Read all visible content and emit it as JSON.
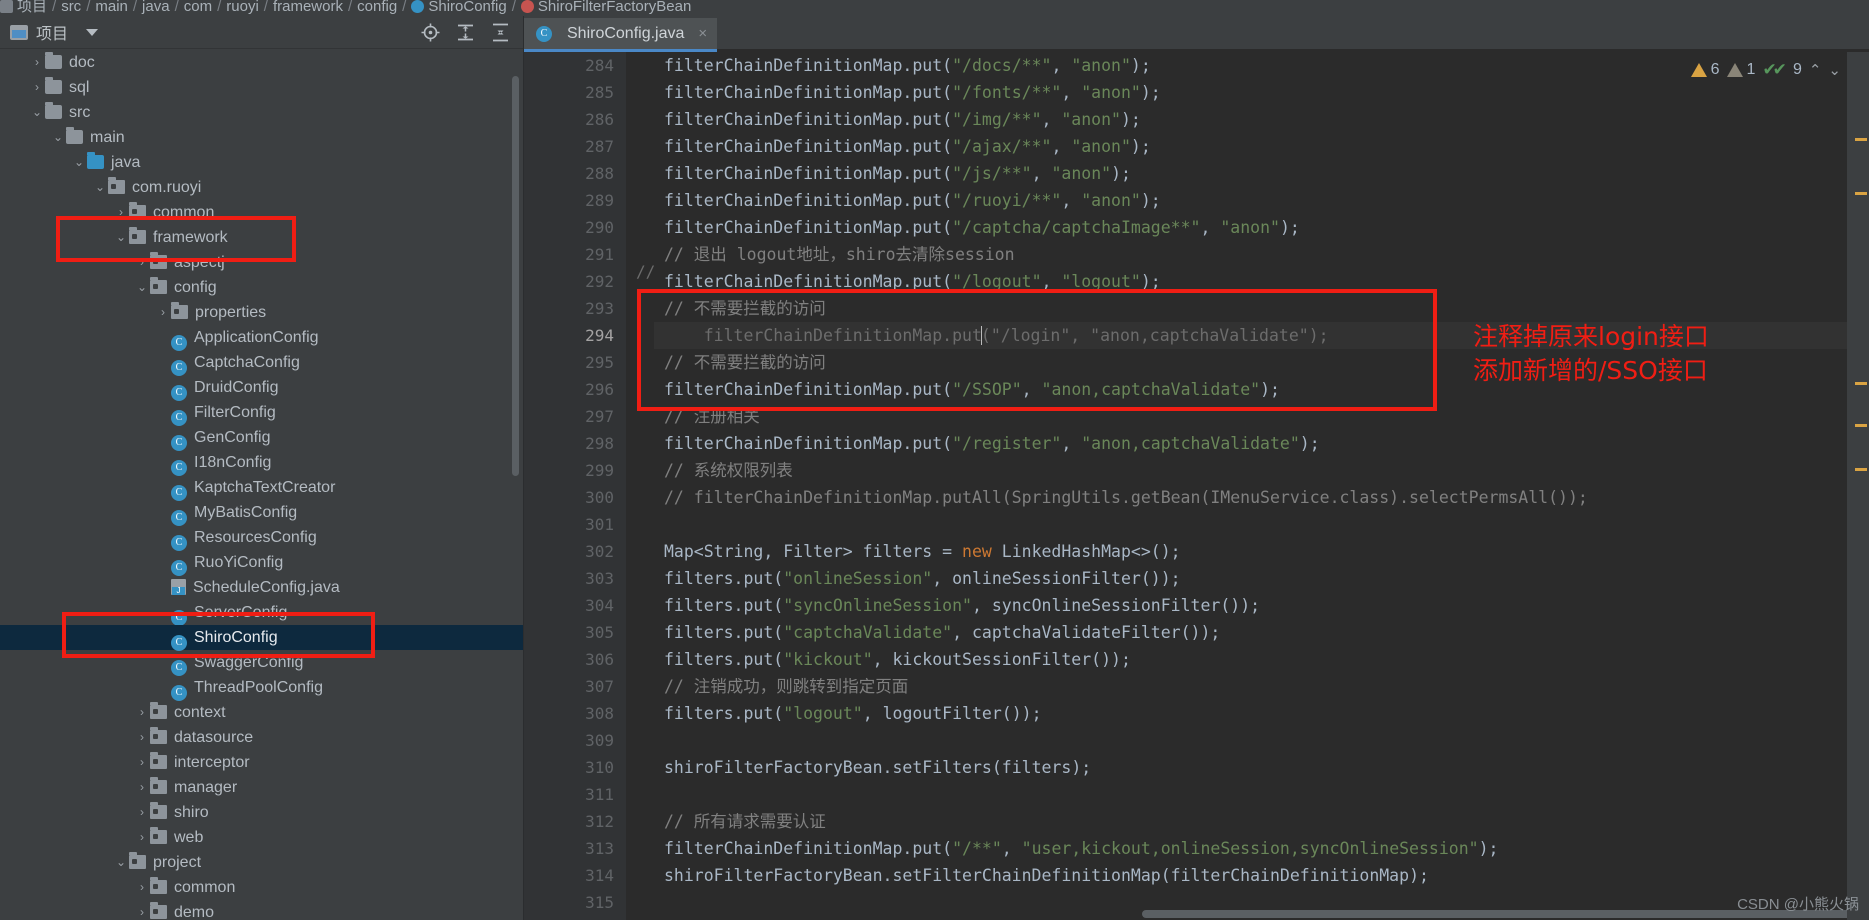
{
  "breadcrumb": {
    "items": [
      "项目",
      "src",
      "main",
      "java",
      "com",
      "ruoyi",
      "framework",
      "config",
      "ShiroConfig",
      "ShiroFilterFactoryBean"
    ],
    "separator": "/"
  },
  "project_panel": {
    "title": "项目",
    "caret": "chevron-down-icon",
    "toolbar_buttons": [
      "locate-icon",
      "expand-all-icon",
      "collapse-all-icon"
    ],
    "tree": [
      {
        "label": "doc",
        "indent": 1,
        "arrow": "collapsed",
        "icon": "folder"
      },
      {
        "label": "sql",
        "indent": 1,
        "arrow": "collapsed",
        "icon": "folder"
      },
      {
        "label": "src",
        "indent": 1,
        "arrow": "expanded",
        "icon": "folder"
      },
      {
        "label": "main",
        "indent": 2,
        "arrow": "expanded",
        "icon": "folder"
      },
      {
        "label": "java",
        "indent": 3,
        "arrow": "expanded",
        "icon": "folder-blue"
      },
      {
        "label": "com.ruoyi",
        "indent": 4,
        "arrow": "expanded",
        "icon": "package"
      },
      {
        "label": "common",
        "indent": 5,
        "arrow": "collapsed",
        "icon": "package"
      },
      {
        "label": "framework",
        "indent": 5,
        "arrow": "expanded",
        "icon": "package"
      },
      {
        "label": "aspectj",
        "indent": 6,
        "arrow": "collapsed",
        "icon": "package"
      },
      {
        "label": "config",
        "indent": 6,
        "arrow": "expanded",
        "icon": "package"
      },
      {
        "label": "properties",
        "indent": 7,
        "arrow": "collapsed",
        "icon": "package"
      },
      {
        "label": "ApplicationConfig",
        "indent": 7,
        "arrow": "none",
        "icon": "class"
      },
      {
        "label": "CaptchaConfig",
        "indent": 7,
        "arrow": "none",
        "icon": "class"
      },
      {
        "label": "DruidConfig",
        "indent": 7,
        "arrow": "none",
        "icon": "class"
      },
      {
        "label": "FilterConfig",
        "indent": 7,
        "arrow": "none",
        "icon": "class"
      },
      {
        "label": "GenConfig",
        "indent": 7,
        "arrow": "none",
        "icon": "class"
      },
      {
        "label": "I18nConfig",
        "indent": 7,
        "arrow": "none",
        "icon": "class"
      },
      {
        "label": "KaptchaTextCreator",
        "indent": 7,
        "arrow": "none",
        "icon": "class"
      },
      {
        "label": "MyBatisConfig",
        "indent": 7,
        "arrow": "none",
        "icon": "class"
      },
      {
        "label": "ResourcesConfig",
        "indent": 7,
        "arrow": "none",
        "icon": "class"
      },
      {
        "label": "RuoYiConfig",
        "indent": 7,
        "arrow": "none",
        "icon": "class"
      },
      {
        "label": "ScheduleConfig.java",
        "indent": 7,
        "arrow": "none",
        "icon": "java-file"
      },
      {
        "label": "ServerConfig",
        "indent": 7,
        "arrow": "none",
        "icon": "class"
      },
      {
        "label": "ShiroConfig",
        "indent": 7,
        "arrow": "none",
        "icon": "class",
        "selected": true
      },
      {
        "label": "SwaggerConfig",
        "indent": 7,
        "arrow": "none",
        "icon": "class"
      },
      {
        "label": "ThreadPoolConfig",
        "indent": 7,
        "arrow": "none",
        "icon": "class"
      },
      {
        "label": "context",
        "indent": 6,
        "arrow": "collapsed",
        "icon": "package"
      },
      {
        "label": "datasource",
        "indent": 6,
        "arrow": "collapsed",
        "icon": "package"
      },
      {
        "label": "interceptor",
        "indent": 6,
        "arrow": "collapsed",
        "icon": "package"
      },
      {
        "label": "manager",
        "indent": 6,
        "arrow": "collapsed",
        "icon": "package"
      },
      {
        "label": "shiro",
        "indent": 6,
        "arrow": "collapsed",
        "icon": "package"
      },
      {
        "label": "web",
        "indent": 6,
        "arrow": "collapsed",
        "icon": "package"
      },
      {
        "label": "project",
        "indent": 5,
        "arrow": "expanded",
        "icon": "package"
      },
      {
        "label": "common",
        "indent": 6,
        "arrow": "collapsed",
        "icon": "package"
      },
      {
        "label": "demo",
        "indent": 6,
        "arrow": "collapsed",
        "icon": "package"
      }
    ]
  },
  "editor": {
    "tab": {
      "label": "ShiroConfig.java",
      "icon": "class-icon",
      "close": "×"
    },
    "toolbar_buttons": [
      "settings-gear-icon",
      "minimize-icon"
    ],
    "first_line_number": 284,
    "current_line": 294,
    "lines": [
      {
        "n": 284,
        "fold": "",
        "text": "filterChainDefinitionMap.put(\"/docs/**\", \"anon\");"
      },
      {
        "n": 285,
        "fold": "",
        "text": "filterChainDefinitionMap.put(\"/fonts/**\", \"anon\");"
      },
      {
        "n": 286,
        "fold": "",
        "text": "filterChainDefinitionMap.put(\"/img/**\", \"anon\");"
      },
      {
        "n": 287,
        "fold": "",
        "text": "filterChainDefinitionMap.put(\"/ajax/**\", \"anon\");"
      },
      {
        "n": 288,
        "fold": "",
        "text": "filterChainDefinitionMap.put(\"/js/**\", \"anon\");"
      },
      {
        "n": 289,
        "fold": "",
        "text": "filterChainDefinitionMap.put(\"/ruoyi/**\", \"anon\");"
      },
      {
        "n": 290,
        "fold": "",
        "text": "filterChainDefinitionMap.put(\"/captcha/captchaImage**\", \"anon\");"
      },
      {
        "n": 291,
        "fold": "",
        "text": "// 退出 logout地址，shiro去清除session"
      },
      {
        "n": 292,
        "fold": "",
        "text": "filterChainDefinitionMap.put(\"/logout\", \"logout\");"
      },
      {
        "n": 293,
        "fold": "open",
        "text": "// 不需要拦截的访问"
      },
      {
        "n": 294,
        "fold": "",
        "text": "    filterChainDefinitionMap.put(\"/login\", \"anon,captchaValidate\");",
        "commented": true,
        "marker": "//"
      },
      {
        "n": 295,
        "fold": "close",
        "text": "// 不需要拦截的访问"
      },
      {
        "n": 296,
        "fold": "",
        "text": "filterChainDefinitionMap.put(\"/SSOP\", \"anon,captchaValidate\");"
      },
      {
        "n": 297,
        "fold": "",
        "text": "// 注册相关"
      },
      {
        "n": 298,
        "fold": "",
        "text": "filterChainDefinitionMap.put(\"/register\", \"anon,captchaValidate\");"
      },
      {
        "n": 299,
        "fold": "open",
        "text": "// 系统权限列表"
      },
      {
        "n": 300,
        "fold": "close",
        "text": "// filterChainDefinitionMap.putAll(SpringUtils.getBean(IMenuService.class).selectPermsAll());"
      },
      {
        "n": 301,
        "fold": "",
        "text": ""
      },
      {
        "n": 302,
        "fold": "",
        "text": "Map<String, Filter> filters = new LinkedHashMap<>();"
      },
      {
        "n": 303,
        "fold": "",
        "text": "filters.put(\"onlineSession\", onlineSessionFilter());"
      },
      {
        "n": 304,
        "fold": "",
        "text": "filters.put(\"syncOnlineSession\", syncOnlineSessionFilter());"
      },
      {
        "n": 305,
        "fold": "",
        "text": "filters.put(\"captchaValidate\", captchaValidateFilter());"
      },
      {
        "n": 306,
        "fold": "",
        "text": "filters.put(\"kickout\", kickoutSessionFilter());"
      },
      {
        "n": 307,
        "fold": "",
        "text": "// 注销成功，则跳转到指定页面"
      },
      {
        "n": 308,
        "fold": "",
        "text": "filters.put(\"logout\", logoutFilter());"
      },
      {
        "n": 309,
        "fold": "",
        "text": ""
      },
      {
        "n": 310,
        "fold": "",
        "text": "shiroFilterFactoryBean.setFilters(filters);"
      },
      {
        "n": 311,
        "fold": "",
        "text": ""
      },
      {
        "n": 312,
        "fold": "",
        "text": "// 所有请求需要认证"
      },
      {
        "n": 313,
        "fold": "",
        "text": "filterChainDefinitionMap.put(\"/**\", \"user,kickout,onlineSession,syncOnlineSession\");"
      },
      {
        "n": 314,
        "fold": "",
        "text": "shiroFilterFactoryBean.setFilterChainDefinitionMap(filterChainDefinitionMap);"
      },
      {
        "n": 315,
        "fold": "",
        "text": ""
      }
    ]
  },
  "status": {
    "warnings": "6",
    "weak_warnings": "1",
    "checks": "9",
    "warning_icon": "warning-triangle-icon",
    "weak_icon": "weak-warning-triangle-icon",
    "check_icon": "double-check-icon",
    "up_icon": "chevron-up-icon",
    "down_icon": "chevron-down-icon"
  },
  "annotations": {
    "text_line1": "注释掉原来login接口",
    "text_line2": "添加新增的/SSO接口",
    "color": "#f01e14"
  },
  "watermark": "CSDN @小熊火锅"
}
